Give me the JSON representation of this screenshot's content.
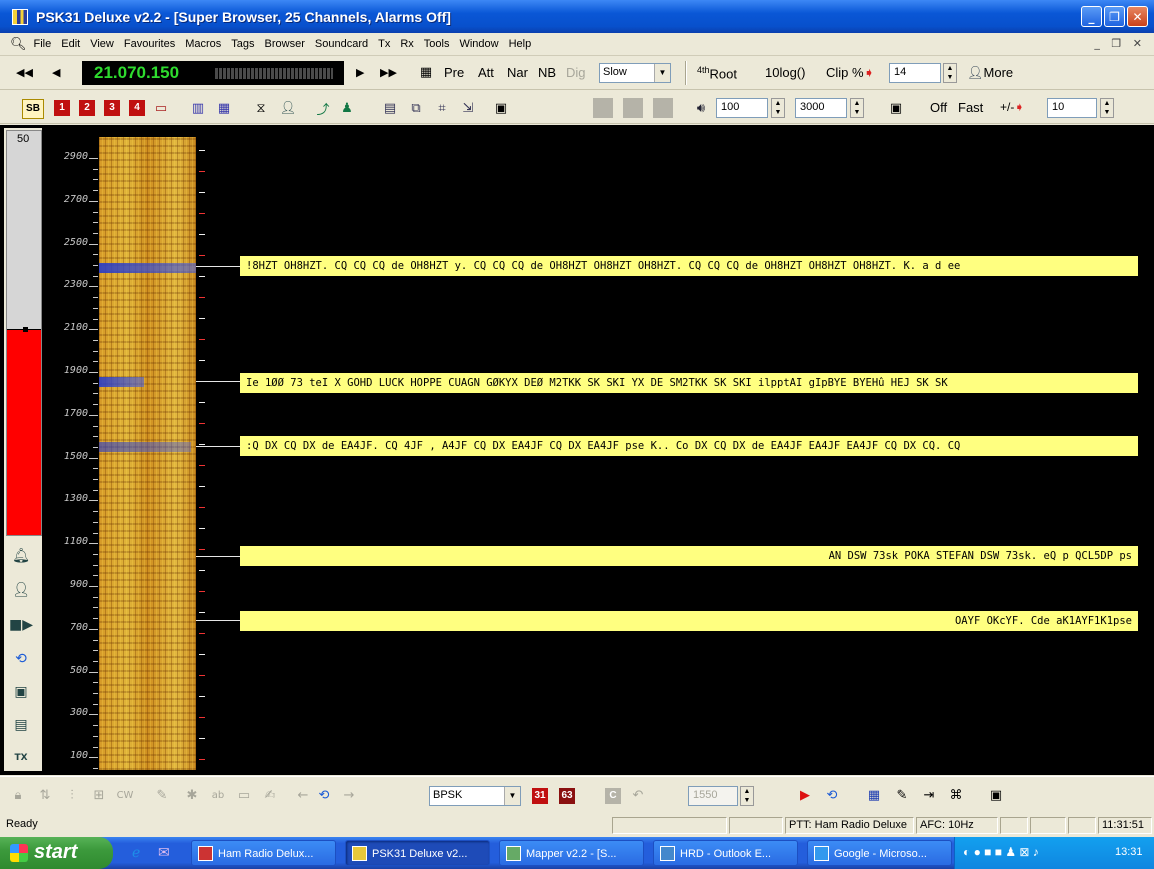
{
  "window": {
    "title": "PSK31 Deluxe v2.2 - [Super Browser, 25 Channels, Alarms Off]",
    "controls": [
      "_",
      "❐",
      "✕"
    ]
  },
  "menu": [
    "File",
    "Edit",
    "View",
    "Favourites",
    "Macros",
    "Tags",
    "Browser",
    "Soundcard",
    "Tx",
    "Rx",
    "Tools",
    "Window",
    "Help"
  ],
  "mdi_controls": "_ ❐ ✕",
  "toolbar1": {
    "frequency": "21.070.150",
    "pre": "Pre",
    "att": "Att",
    "nar": "Nar",
    "nb": "NB",
    "dig": "Dig",
    "speed": "Slow",
    "root": "4th",
    "root_suffix": "Root",
    "log": "10log()",
    "clip": "Clip %",
    "clip_value": "14",
    "more": "More"
  },
  "toolbar2": {
    "sb": "SB",
    "mem1": "1",
    "mem2": "2",
    "mem3": "3",
    "mem4": "4",
    "low": "100",
    "high": "3000",
    "off": "Off",
    "fast": "Fast",
    "plusminus": "+/-",
    "pm_value": "10"
  },
  "level_meter": {
    "value": "50",
    "fill_fraction": 0.5
  },
  "axis": {
    "labels": [
      "2900",
      "2700",
      "2500",
      "2300",
      "2100",
      "1900",
      "1700",
      "1500",
      "1300",
      "1100",
      "900",
      "700",
      "500",
      "300",
      "100"
    ]
  },
  "channels": [
    {
      "text": "!8HZT OH8HZT. CQ CQ CQ de OH8HZT y. CQ CQ CQ de OH8HZT OH8HZT OH8HZT. CQ CQ CQ de OH8HZT OH8HZT OH8HZT. K. a d ee"
    },
    {
      "text": "Ie 1ØØ 73 teI X GOHD LUCK HOPPE CUAGN GØKYX DEØ M2TKK SK SKI YX DE SM2TKK SK SKI ilpptAI gIpBYE BYEHû HEJ SK SK"
    },
    {
      "text": ":Q DX CQ DX de EA4JF. CQ 4JF , A4JF CQ DX EA4JF CQ DX EA4JF pse K.. Co DX CQ DX de EA4JF EA4JF EA4JF CQ DX CQ. CQ"
    },
    {
      "text": "AN DSW 73sk POKA STEFAN DSW 73sk. eQ p QCL5DP ps"
    },
    {
      "text": "OAYF OKcYF. Cde aK1AYF1K1pse"
    }
  ],
  "bottom_toolbar": {
    "mode": "BPSK",
    "m31": "31",
    "m63": "63",
    "c": "C",
    "freq_value": "1550"
  },
  "status": {
    "ready": "Ready",
    "ptt": "PTT: Ham Radio Deluxe",
    "afc": "AFC: 10Hz",
    "time": "11:31:51"
  },
  "taskbar": {
    "start": "start",
    "tasks": [
      "Ham Radio Delux...",
      "PSK31 Deluxe v2...",
      "Mapper v2.2 - [S...",
      "HRD - Outlook E...",
      "Google - Microso..."
    ],
    "clock": "13:31"
  },
  "colors": {
    "titlebar": "#0a57d6",
    "frequency_text": "#2edb2e",
    "channel_bg": "#ffff80",
    "level_fill": "#ff0000"
  }
}
